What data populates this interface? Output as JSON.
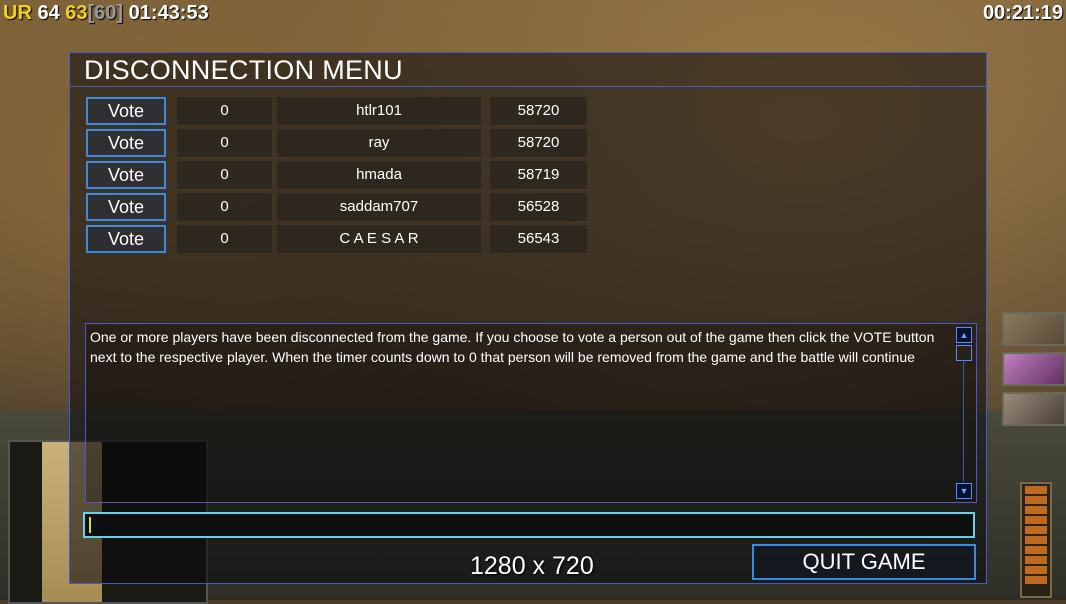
{
  "hud": {
    "top_left": {
      "ur": "UR",
      "a": "64",
      "b": "63",
      "c": "[60]",
      "time": "01:43:53"
    },
    "top_right_time": "00:21:19"
  },
  "dialog": {
    "title": "DISCONNECTION MENU",
    "players": [
      {
        "vote_label": "Vote",
        "votes": "0",
        "name": "htlr101",
        "ping": "58720"
      },
      {
        "vote_label": "Vote",
        "votes": "0",
        "name": "ray",
        "ping": "58720"
      },
      {
        "vote_label": "Vote",
        "votes": "0",
        "name": "hmada",
        "ping": "58719"
      },
      {
        "vote_label": "Vote",
        "votes": "0",
        "name": "saddam707",
        "ping": "56528"
      },
      {
        "vote_label": "Vote",
        "votes": "0",
        "name": "C A E S A R",
        "ping": "56543"
      }
    ],
    "message": "One or more players have been disconnected from the game. If you choose to vote a person out of the game then click the VOTE button next to the respective player. When the timer counts down to 0 that person will be removed from the game and the battle will continue",
    "chat_value": "",
    "quit_label": "QUIT GAME"
  },
  "overlay_resolution": "1280 x 720",
  "colors": {
    "accent_border": "#3a8ae0",
    "input_border": "#6ad0e0",
    "ur_yellow": "#f4d020"
  }
}
